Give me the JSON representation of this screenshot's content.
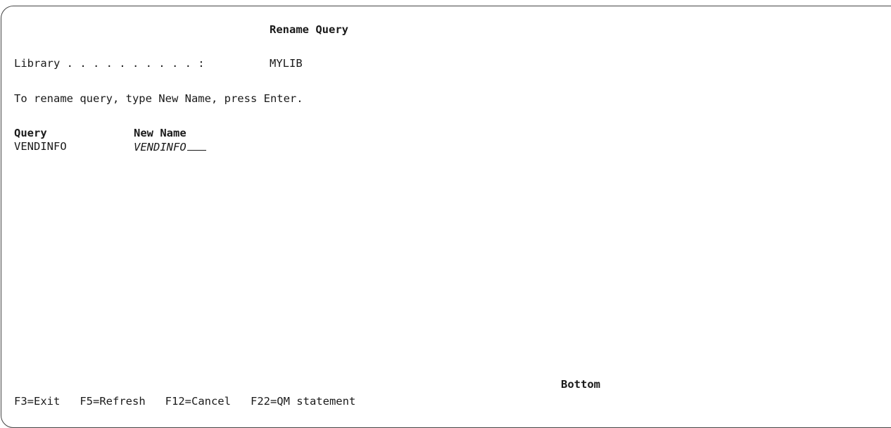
{
  "screen": {
    "title": "Rename Query",
    "library_label": "Library . . . . . . . . . . :",
    "library_value": "MYLIB",
    "instruction": "To rename query, type New Name, press Enter.",
    "columns": {
      "query": "Query",
      "new_name": "New Name"
    },
    "rows": [
      {
        "query": "VENDINFO",
        "new_name": "VENDINFO"
      }
    ],
    "status": "Bottom"
  },
  "function_keys": [
    {
      "label": "F3=Exit"
    },
    {
      "label": "F5=Refresh"
    },
    {
      "label": "F12=Cancel"
    },
    {
      "label": "F22=QM statement"
    }
  ]
}
